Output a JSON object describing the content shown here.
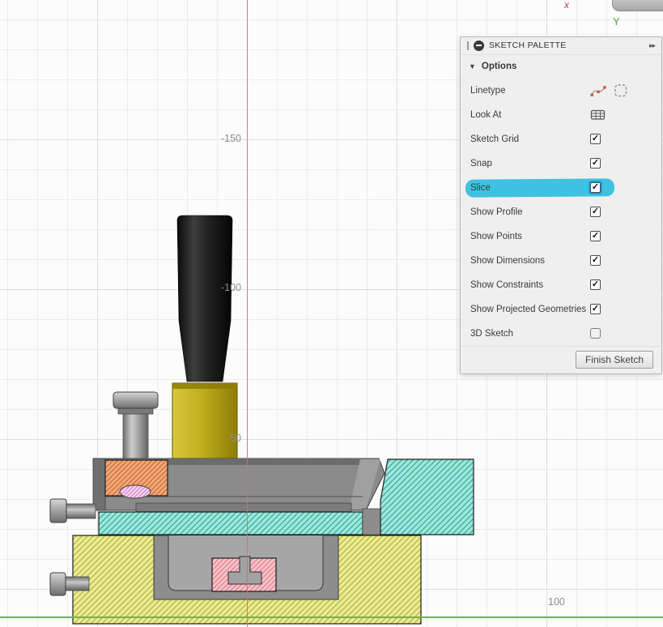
{
  "canvas": {
    "axis_labels": {
      "y_150": "-150",
      "y_100": "-100",
      "y_50": "-50",
      "x_100": "100"
    },
    "origin": {
      "x_label": "x",
      "y_label": "Y"
    }
  },
  "palette": {
    "title": "SKETCH PALETTE",
    "collapse_icon": "▸▸",
    "options_caret": "▼",
    "options_label": "Options",
    "rows": [
      {
        "label": "Linetype"
      },
      {
        "label": "Look At"
      },
      {
        "label": "Sketch Grid",
        "check": "✓"
      },
      {
        "label": "Snap",
        "check": "✓"
      },
      {
        "label": "Slice",
        "check": "✓",
        "highlighted": true
      },
      {
        "label": "Show Profile",
        "check": "✓"
      },
      {
        "label": "Show Points",
        "check": "✓"
      },
      {
        "label": "Show Dimensions",
        "check": "✓"
      },
      {
        "label": "Show Constraints",
        "check": "✓"
      },
      {
        "label": "Show Projected Geometries",
        "check": "✓"
      },
      {
        "label": "3D Sketch",
        "check": ""
      }
    ],
    "finish_button": "Finish Sketch"
  },
  "icons": {
    "palette_menu": "minus-circle",
    "collapse": "double-chevron-right",
    "linetype_spline": "spline-with-points",
    "linetype_construction": "dashed-square",
    "look_at": "grid-plane",
    "checkbox_check": "check-mark"
  },
  "colors": {
    "slice_highlight": "#3fc1e2",
    "slice_checkbox_ring": "#1a9fd0",
    "axis_red": "#c07a70",
    "axis_green": "#78b14b",
    "hatch_cyan_bg": "#9ce7db",
    "hatch_cyan_line": "#2fa093",
    "hatch_yellow_bg": "#ebeb8f",
    "hatch_yellow_line": "#a9a93f",
    "hatch_orange_bg": "#f2a978",
    "hatch_orange_line": "#c2602f",
    "hatch_pink_bg": "#f7c3c9",
    "hatch_pink_line": "#dd7083",
    "hatch_magenta_bg": "#f5d3f0",
    "hatch_magenta_line": "#c36cbb"
  }
}
